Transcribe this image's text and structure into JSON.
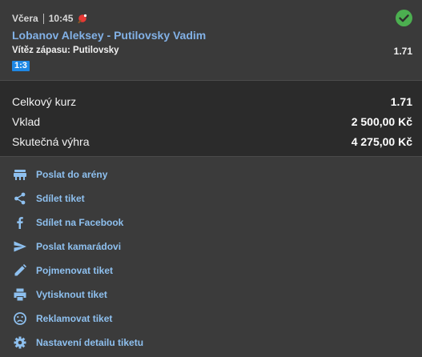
{
  "ticket": {
    "day": "Včera",
    "time": "10:45",
    "match": "Lobanov Aleksey - Putilovsky Vadim",
    "pick": "Vítěz zápasu: Putilovsky",
    "pick_odd": "1.71",
    "score": "1:3",
    "status": "won",
    "colors": {
      "match_link": "#82b1e6",
      "check": "#4caf50",
      "score_badge": "#1e88e5"
    }
  },
  "summary": {
    "total_odds_label": "Celkový kurz",
    "total_odds_value": "1.71",
    "stake_label": "Vklad",
    "stake_value": "2 500,00 Kč",
    "win_label": "Skutečná výhra",
    "win_value": "4 275,00 Kč"
  },
  "actions": [
    {
      "label": "Poslat do arény",
      "icon": "arena-icon"
    },
    {
      "label": "Sdílet tiket",
      "icon": "share-icon"
    },
    {
      "label": "Sdílet na Facebook",
      "icon": "facebook-icon"
    },
    {
      "label": "Poslat kamarádovi",
      "icon": "send-icon"
    },
    {
      "label": "Pojmenovat tiket",
      "icon": "pencil-icon"
    },
    {
      "label": "Vytisknout tiket",
      "icon": "printer-icon"
    },
    {
      "label": "Reklamovat tiket",
      "icon": "sad-face-icon"
    },
    {
      "label": "Nastavení detailu tiketu",
      "icon": "gear-icon"
    }
  ]
}
